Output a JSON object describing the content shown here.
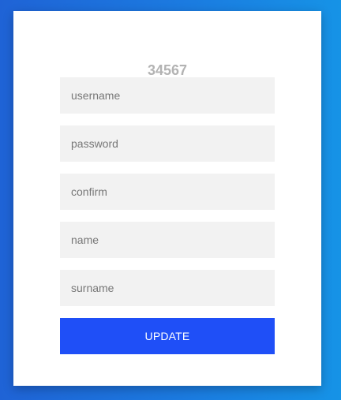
{
  "form": {
    "title": "34567",
    "fields": [
      {
        "name": "username",
        "placeholder": "username",
        "value": ""
      },
      {
        "name": "password",
        "placeholder": "password",
        "value": ""
      },
      {
        "name": "confirm",
        "placeholder": "confirm",
        "value": ""
      },
      {
        "name": "name",
        "placeholder": "name",
        "value": ""
      },
      {
        "name": "surname",
        "placeholder": "surname",
        "value": ""
      }
    ],
    "submit_label": "UPDATE"
  },
  "colors": {
    "button": "#1f4ff7",
    "field_background": "#f2f2f2",
    "title": "#b3b3b3"
  }
}
